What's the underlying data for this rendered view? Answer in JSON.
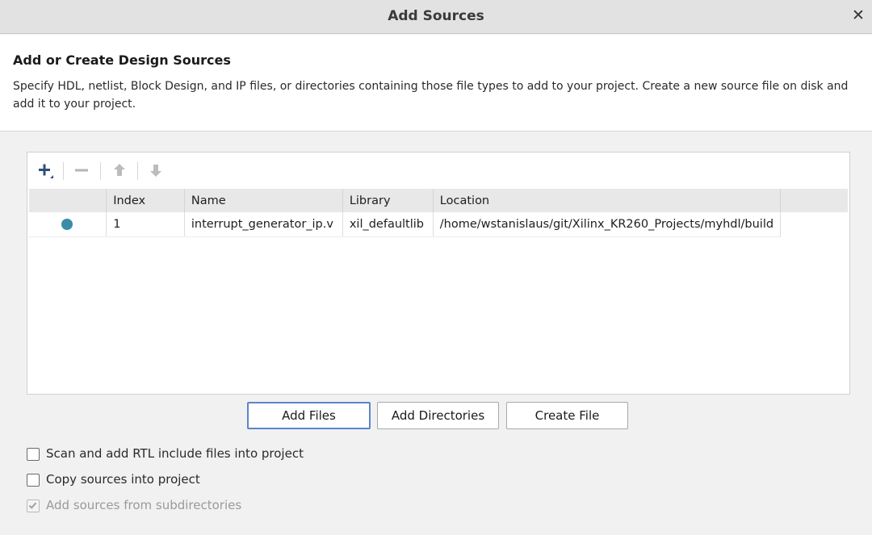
{
  "window": {
    "title": "Add Sources"
  },
  "header": {
    "title": "Add or Create Design Sources",
    "description": "Specify HDL, netlist, Block Design, and IP files, or directories containing those file types to add to your project. Create a new source file on disk and add it to your project."
  },
  "toolbar": {
    "add_icon": "plus-icon",
    "remove_icon": "minus-icon",
    "up_icon": "arrow-up-icon",
    "down_icon": "arrow-down-icon"
  },
  "table": {
    "columns": [
      "",
      "Index",
      "Name",
      "Library",
      "Location"
    ],
    "rows": [
      {
        "status_color": "#3a8ca8",
        "index": "1",
        "name": "interrupt_generator_ip.v",
        "library": "xil_defaultlib",
        "location": "/home/wstanislaus/git/Xilinx_KR260_Projects/myhdl/build"
      }
    ]
  },
  "buttons": {
    "add_files": "Add Files",
    "add_directories": "Add Directories",
    "create_file": "Create File"
  },
  "options": {
    "scan_rtl": {
      "label": "Scan and add RTL include files into project",
      "checked": false
    },
    "copy_sources": {
      "label": "Copy sources into project",
      "checked": false
    },
    "add_subdirs": {
      "label": "Add sources from subdirectories",
      "checked": true,
      "disabled": true
    }
  },
  "colors": {
    "accent": "#5b86c8",
    "status_dot": "#3a8ca8"
  }
}
